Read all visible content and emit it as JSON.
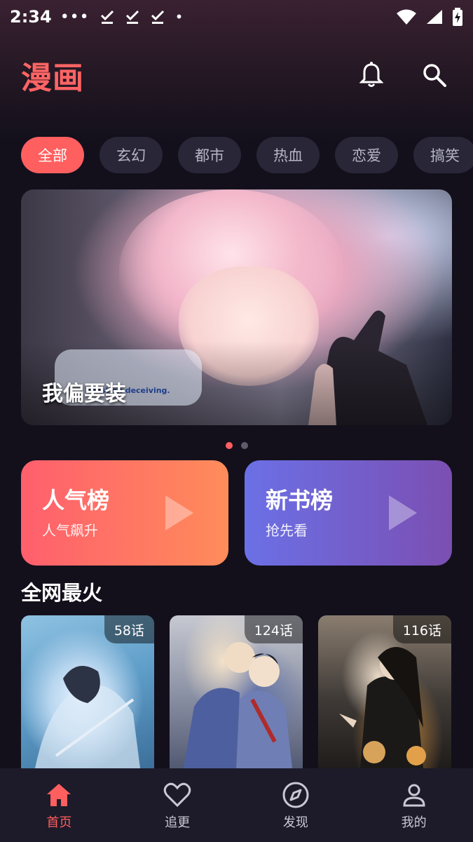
{
  "status_bar": {
    "time": "2:34",
    "dots": "•••",
    "notification_dot": "•"
  },
  "header": {
    "title": "漫画",
    "bell_icon": "bell-icon",
    "search_icon": "search-icon"
  },
  "categories": [
    {
      "label": "全部",
      "active": true
    },
    {
      "label": "玄幻",
      "active": false
    },
    {
      "label": "都市",
      "active": false
    },
    {
      "label": "热血",
      "active": false
    },
    {
      "label": "恋爱",
      "active": false
    },
    {
      "label": "搞笑",
      "active": false
    }
  ],
  "banner": {
    "title": "我偏要装",
    "logo_text": "我偏要装",
    "logo_subtitle": "I insist on deceiving.",
    "page_count": 2,
    "current_page": 1
  },
  "rank_cards": {
    "popular": {
      "title": "人气榜",
      "subtitle": "人气飙升"
    },
    "newbook": {
      "title": "新书榜",
      "subtitle": "抢先看"
    }
  },
  "section": {
    "title": "全网最火"
  },
  "comics": [
    {
      "episodes": "58话"
    },
    {
      "episodes": "124话"
    },
    {
      "episodes": "116话"
    }
  ],
  "bottom_nav": [
    {
      "label": "首页",
      "icon": "home-icon",
      "active": true
    },
    {
      "label": "追更",
      "icon": "heart-icon",
      "active": false
    },
    {
      "label": "发现",
      "icon": "compass-icon",
      "active": false
    },
    {
      "label": "我的",
      "icon": "person-icon",
      "active": false
    }
  ],
  "colors": {
    "accent": "#ff5f5f",
    "background": "#13101c",
    "chip": "#282637",
    "nav_bg": "#1d1b2a"
  }
}
